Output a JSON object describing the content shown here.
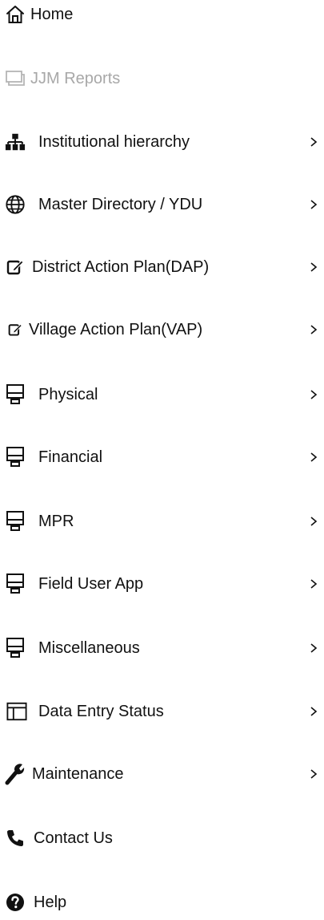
{
  "menu": {
    "items": [
      {
        "label": "Home",
        "icon": "home-icon",
        "has_submenu": false
      },
      {
        "label": "JJM Reports",
        "icon": "monitor-outline-icon",
        "has_submenu": false,
        "disabled": true
      },
      {
        "label": "Institutional hierarchy",
        "icon": "sitemap-icon",
        "has_submenu": true
      },
      {
        "label": "Master Directory / YDU",
        "icon": "globe-icon",
        "has_submenu": true
      },
      {
        "label": "District Action Plan(DAP)",
        "icon": "edit-icon",
        "has_submenu": true
      },
      {
        "label": "Village Action Plan(VAP)",
        "icon": "edit-icon",
        "has_submenu": true
      },
      {
        "label": "Physical",
        "icon": "desktop-icon",
        "has_submenu": true
      },
      {
        "label": "Financial",
        "icon": "desktop-icon",
        "has_submenu": true
      },
      {
        "label": "MPR",
        "icon": "desktop-icon",
        "has_submenu": true
      },
      {
        "label": "Field User App",
        "icon": "desktop-icon",
        "has_submenu": true
      },
      {
        "label": "Miscellaneous",
        "icon": "desktop-icon",
        "has_submenu": true
      },
      {
        "label": "Data Entry Status",
        "icon": "layout-table-icon",
        "has_submenu": true
      },
      {
        "label": "Maintenance",
        "icon": "wrench-icon",
        "has_submenu": true
      },
      {
        "label": "Contact Us",
        "icon": "phone-icon",
        "has_submenu": false
      },
      {
        "label": "Help",
        "icon": "help-circle-icon",
        "has_submenu": false
      }
    ]
  },
  "colors": {
    "text": "#111111",
    "disabled_text": "#a8a8a8",
    "background": "#ffffff"
  }
}
